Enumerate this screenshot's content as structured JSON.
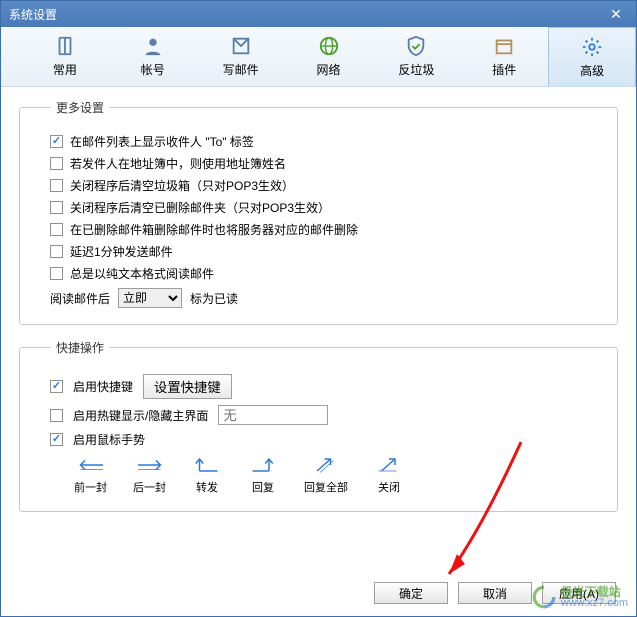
{
  "window": {
    "title": "系统设置"
  },
  "tabs": [
    {
      "label": "常用"
    },
    {
      "label": "帐号"
    },
    {
      "label": "写邮件"
    },
    {
      "label": "网络"
    },
    {
      "label": "反垃圾"
    },
    {
      "label": "插件"
    },
    {
      "label": "高级"
    }
  ],
  "moreSettings": {
    "title": "更多设置",
    "items": [
      {
        "checked": true,
        "label": "在邮件列表上显示收件人 \"To\" 标签"
      },
      {
        "checked": false,
        "label": "若发件人在地址簿中，则使用地址簿姓名"
      },
      {
        "checked": false,
        "label": "关闭程序后清空垃圾箱（只对POP3生效）"
      },
      {
        "checked": false,
        "label": "关闭程序后清空已删除邮件夹（只对POP3生效）"
      },
      {
        "checked": false,
        "label": "在已删除邮件箱删除邮件时也将服务器对应的邮件删除"
      },
      {
        "checked": false,
        "label": "延迟1分钟发送邮件"
      },
      {
        "checked": false,
        "label": "总是以纯文本格式阅读邮件"
      }
    ],
    "readRow": {
      "prefix": "阅读邮件后",
      "selected": "立即",
      "suffix": "标为已读"
    }
  },
  "shortcuts": {
    "title": "快捷操作",
    "enableShortcut": {
      "checked": true,
      "label": "启用快捷键",
      "button": "设置快捷键"
    },
    "enableHotkey": {
      "checked": false,
      "label": "启用热键显示/隐藏主界面",
      "placeholder": "无"
    },
    "enableGesture": {
      "checked": true,
      "label": "启用鼠标手势"
    },
    "gestures": [
      {
        "label": "前一封"
      },
      {
        "label": "后一封"
      },
      {
        "label": "转发"
      },
      {
        "label": "回复"
      },
      {
        "label": "回复全部"
      },
      {
        "label": "关闭"
      }
    ]
  },
  "footer": {
    "ok": "确定",
    "cancel": "取消",
    "apply": "应用(A)"
  },
  "watermark": {
    "cn": "极光下载站",
    "url": "www.xz7.com"
  }
}
